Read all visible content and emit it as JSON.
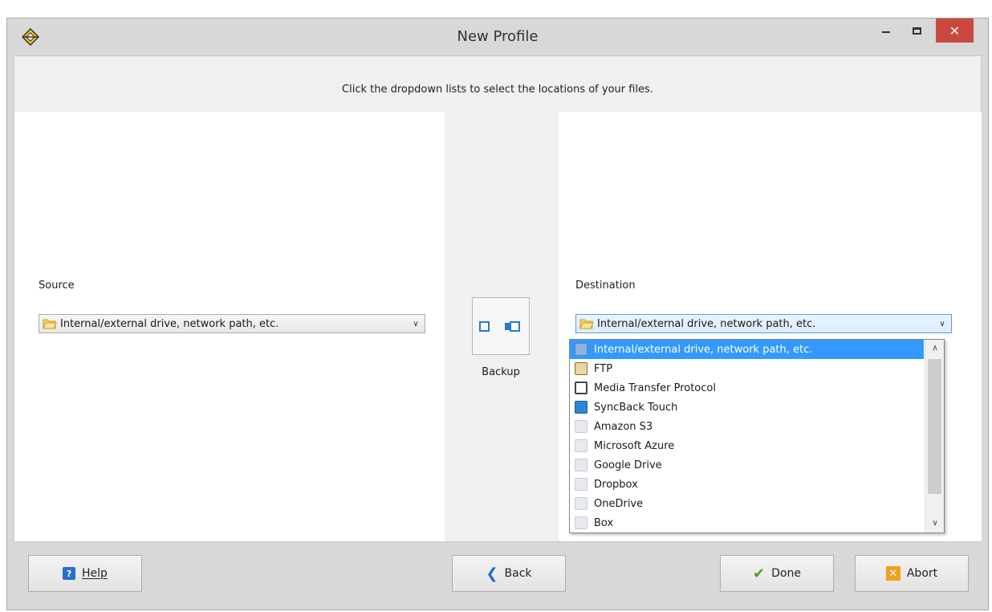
{
  "window": {
    "title": "New Profile",
    "close_glyph": "✕"
  },
  "instruction": "Click the dropdown lists to select the locations of your files.",
  "source": {
    "label": "Source",
    "selected": "Internal/external drive, network path, etc."
  },
  "direction": {
    "label": "Backup"
  },
  "destination": {
    "label": "Destination",
    "selected": "Internal/external drive, network path, etc.",
    "options": [
      {
        "label": "Internal/external drive, network path, etc.",
        "icon": "drive-icon",
        "selected": true
      },
      {
        "label": "FTP",
        "icon": "ftp-icon"
      },
      {
        "label": "Media Transfer Protocol",
        "icon": "device-icon"
      },
      {
        "label": "SyncBack Touch",
        "icon": "syncback-touch-icon"
      },
      {
        "label": "Amazon S3",
        "icon": "cloud-icon"
      },
      {
        "label": "Microsoft Azure",
        "icon": "cloud-icon"
      },
      {
        "label": "Google Drive",
        "icon": "cloud-icon"
      },
      {
        "label": "Dropbox",
        "icon": "cloud-icon"
      },
      {
        "label": "OneDrive",
        "icon": "cloud-icon"
      },
      {
        "label": "Box",
        "icon": "cloud-icon"
      }
    ]
  },
  "buttons": {
    "help": "Help",
    "back": "Back",
    "done": "Done",
    "abort": "Abort"
  },
  "colors": {
    "accent": "#3399ff",
    "close": "#c9483f",
    "done_check": "#4aa02c",
    "abort": "#f0a020"
  }
}
